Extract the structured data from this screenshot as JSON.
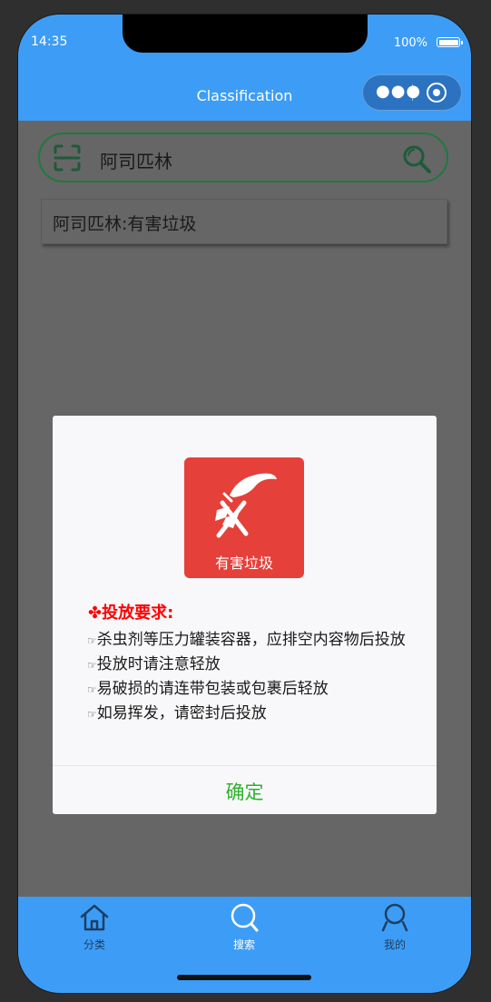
{
  "status_bar": {
    "time": "14:35",
    "battery": "100%"
  },
  "nav": {
    "title": "Classification"
  },
  "search": {
    "query": "阿司匹林"
  },
  "result": {
    "text": "阿司匹林:有害垃圾"
  },
  "modal": {
    "badge_label": "有害垃圾",
    "badge_color": "#e5403a",
    "requirements_title": "✤投放要求:",
    "bullet": "☞",
    "requirements": [
      "杀虫剂等压力罐装容器，应排空内容物后投放",
      "投放时请注意轻放",
      "易破损的请连带包装或包裹后轻放",
      "如易挥发，请密封后投放"
    ],
    "confirm_label": "确定"
  },
  "tabs": [
    {
      "label": "分类",
      "icon": "home-icon",
      "active": false
    },
    {
      "label": "搜索",
      "icon": "search-icon",
      "active": true
    },
    {
      "label": "我的",
      "icon": "user-icon",
      "active": false
    }
  ],
  "colors": {
    "brand": "#3d9df6",
    "overlay": "#666666",
    "danger": "#ff0000",
    "confirm": "#2fb12f"
  }
}
